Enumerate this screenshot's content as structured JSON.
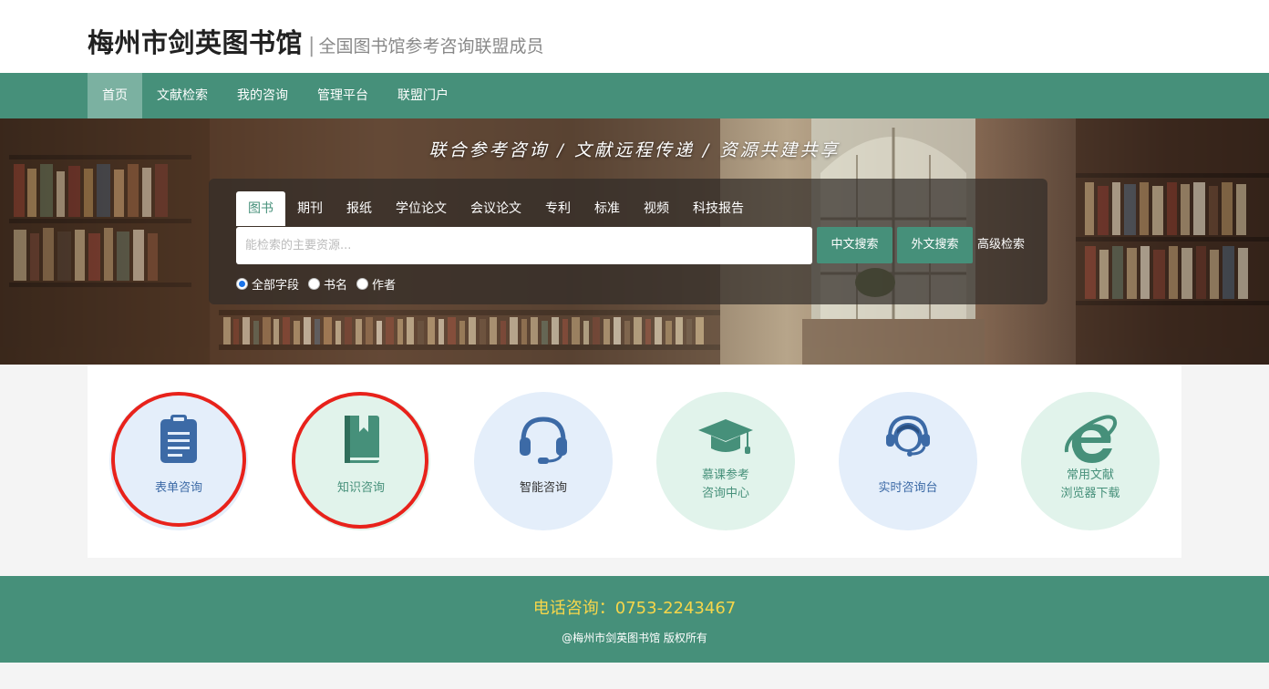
{
  "header": {
    "title": "梅州市剑英图书馆",
    "separator": "|",
    "subtitle": "全国图书馆参考咨询联盟成员"
  },
  "nav": {
    "items": [
      {
        "label": "首页",
        "active": true
      },
      {
        "label": "文献检索"
      },
      {
        "label": "我的咨询"
      },
      {
        "label": "管理平台"
      },
      {
        "label": "联盟门户"
      }
    ]
  },
  "banner": {
    "slogan": "联合参考咨询 / 文献远程传递 / 资源共建共享"
  },
  "search": {
    "tabs": [
      "图书",
      "期刊",
      "报纸",
      "学位论文",
      "会议论文",
      "专利",
      "标准",
      "视频",
      "科技报告"
    ],
    "active_tab": "图书",
    "placeholder": "能检索的主要资源...",
    "value": "",
    "btn_cn": "中文搜索",
    "btn_en": "外文搜索",
    "advanced": "高级检索",
    "fields": [
      {
        "label": "全部字段",
        "checked": true
      },
      {
        "label": "书名",
        "checked": false
      },
      {
        "label": "作者",
        "checked": false
      }
    ]
  },
  "services": [
    {
      "label": "表单咨询",
      "icon": "clipboard-icon",
      "tone": "blue",
      "highlighted": true
    },
    {
      "label": "知识咨询",
      "icon": "book-icon",
      "tone": "green",
      "highlighted": true
    },
    {
      "label": "智能咨询",
      "icon": "headset-icon",
      "tone": "blue",
      "highlighted": false
    },
    {
      "label": "慕课参考\n咨询中心",
      "line1": "慕课参考",
      "line2": "咨询中心",
      "icon": "graduation-cap-icon",
      "tone": "green",
      "highlighted": false
    },
    {
      "label": "实时咨询台",
      "icon": "support-agent-icon",
      "tone": "blue",
      "highlighted": false
    },
    {
      "label": "常用文献\n浏览器下载",
      "line1": "常用文献",
      "line2": "浏览器下载",
      "icon": "ie-browser-icon",
      "tone": "green",
      "highlighted": false
    }
  ],
  "footer": {
    "phone": "电话咨询：0753-2243467",
    "copyright": "@梅州市剑英图书馆 版权所有"
  },
  "colors": {
    "primary": "#46907a",
    "nav_active": "#7bb1a1",
    "icon_blue": "#3c6aa6",
    "icon_green": "#46907a",
    "highlight_ring": "#e8221b",
    "phone": "#f7d64a"
  }
}
